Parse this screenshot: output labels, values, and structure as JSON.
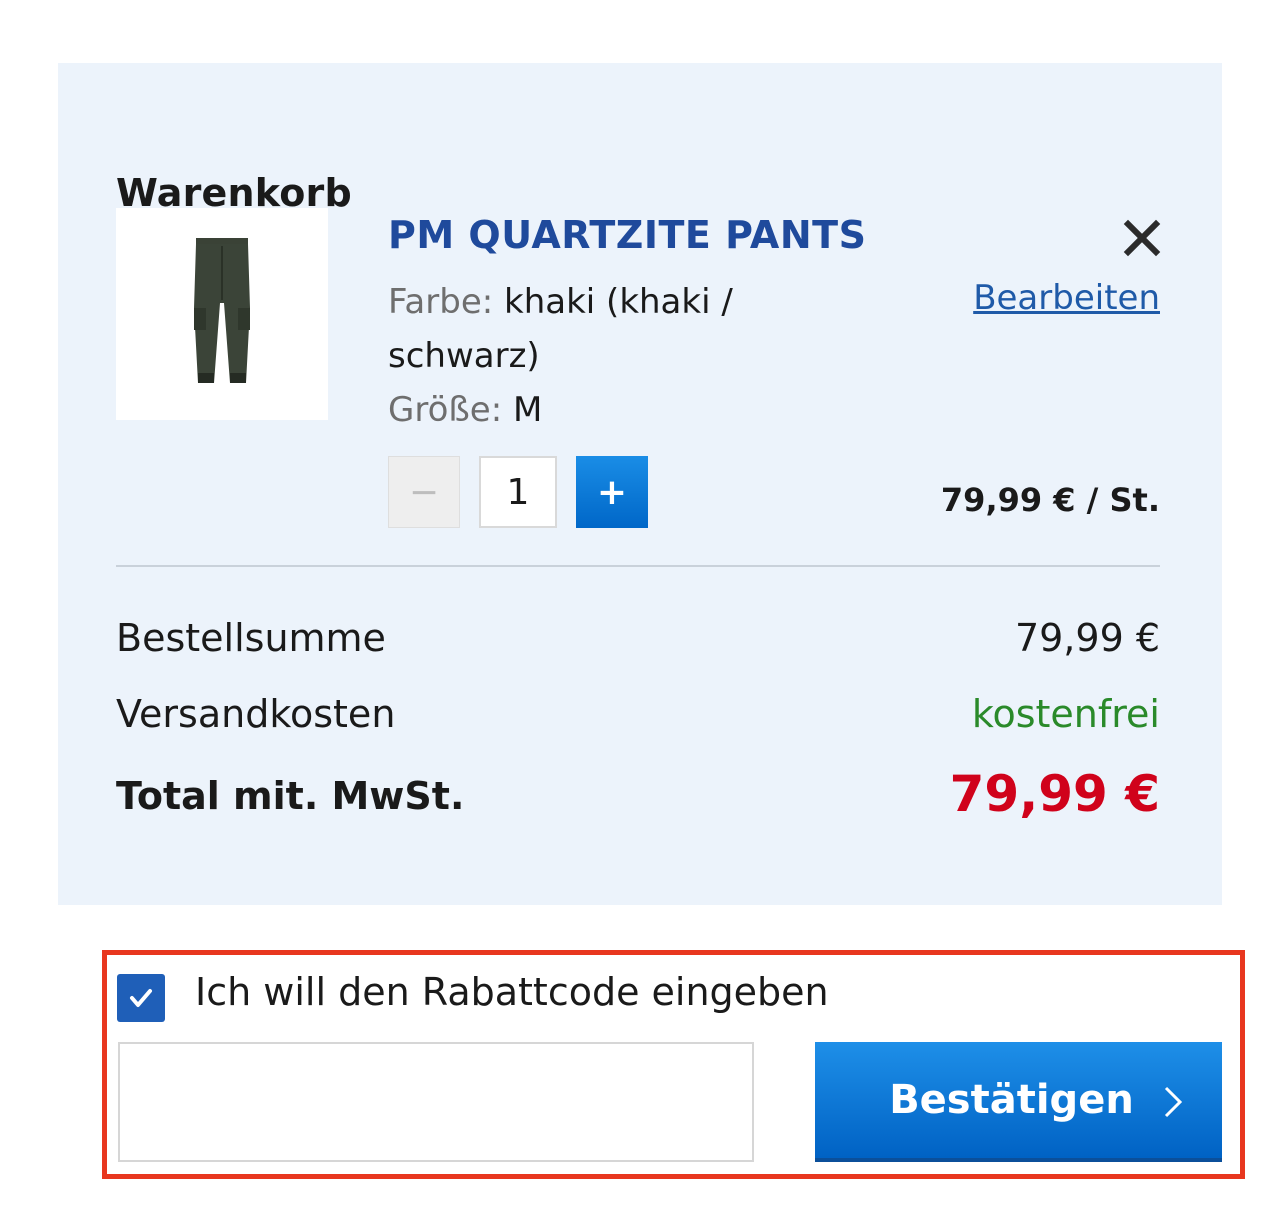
{
  "cart": {
    "title": "Warenkorb",
    "item": {
      "name": "PM QUARTZITE PANTS",
      "color_label": "Farbe:",
      "color_value_line1": "khaki (khaki /",
      "color_value_line2": "schwarz)",
      "size_label": "Größe:",
      "size_value": "M",
      "edit_label": "Bearbeiten",
      "remove_icon": "close-icon",
      "qty_minus": "−",
      "quantity": "1",
      "qty_plus": "+",
      "unit_price": "79,99 € / St.",
      "image_icon": "pants-product-image"
    },
    "summary": {
      "subtotal_label": "Bestellsumme",
      "subtotal_value": "79,99 €",
      "shipping_label": "Versandkosten",
      "shipping_value": "kostenfrei",
      "total_label": "Total mit. MwSt.",
      "total_value": "79,99 €"
    }
  },
  "coupon": {
    "checkbox_checked": true,
    "checkbox_label": "Ich will den Rabattcode eingeben",
    "input_value": "",
    "input_placeholder": "",
    "confirm_label": "Bestätigen",
    "confirm_icon": "chevron-right-icon"
  },
  "colors": {
    "panel_bg": "#ecf3fb",
    "link_blue": "#1f4a9c",
    "accent_blue": "#0067c8",
    "total_red": "#d0021b",
    "free_green": "#2a8a2a",
    "highlight_border": "#e8371f"
  }
}
